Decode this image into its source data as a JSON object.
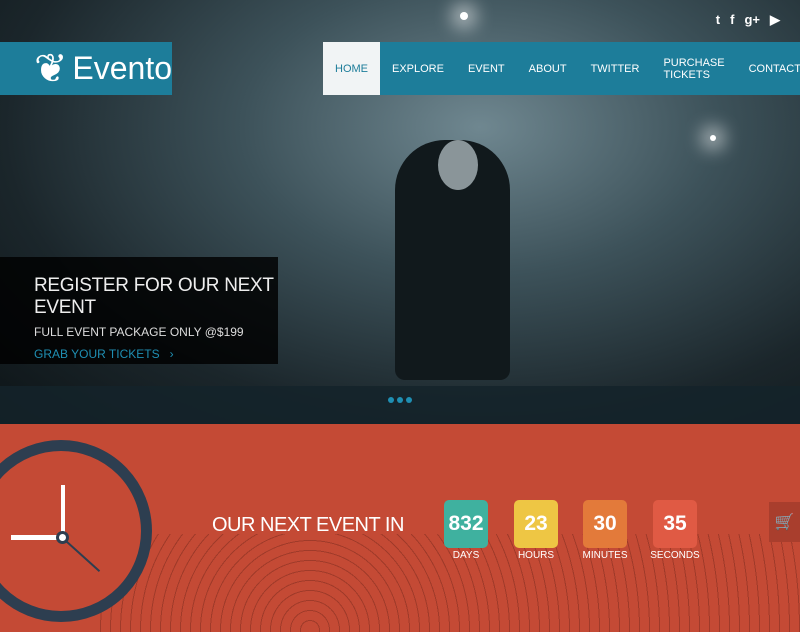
{
  "brand": {
    "name": "Evento"
  },
  "social": [
    {
      "icon": "twitter-icon",
      "glyph": "t"
    },
    {
      "icon": "facebook-icon",
      "glyph": "f"
    },
    {
      "icon": "google-plus-icon",
      "glyph": "g+"
    },
    {
      "icon": "youtube-icon",
      "glyph": "▶"
    }
  ],
  "nav": [
    "HOME",
    "EXPLORE",
    "EVENT",
    "ABOUT",
    "TWITTER",
    "PURCHASE TICKETS",
    "CONTACT"
  ],
  "slider": {
    "title": "REGISTER FOR OUR NEXT EVENT",
    "subtitle": "FULL EVENT PACKAGE ONLY @$199",
    "link": "GRAB YOUR TICKETS",
    "link_arrow": "›"
  },
  "countdown": {
    "heading": "OUR NEXT EVENT IN",
    "items": [
      {
        "value": "832",
        "label": "DAYS",
        "color": "#3fb19f"
      },
      {
        "value": "23",
        "label": "HOURS",
        "color": "#eec644"
      },
      {
        "value": "30",
        "label": "MINUTES",
        "color": "#e37a3a"
      },
      {
        "value": "35",
        "label": "SECONDS",
        "color": "#e05a44"
      }
    ]
  },
  "cart": {
    "glyph": "🛒"
  }
}
